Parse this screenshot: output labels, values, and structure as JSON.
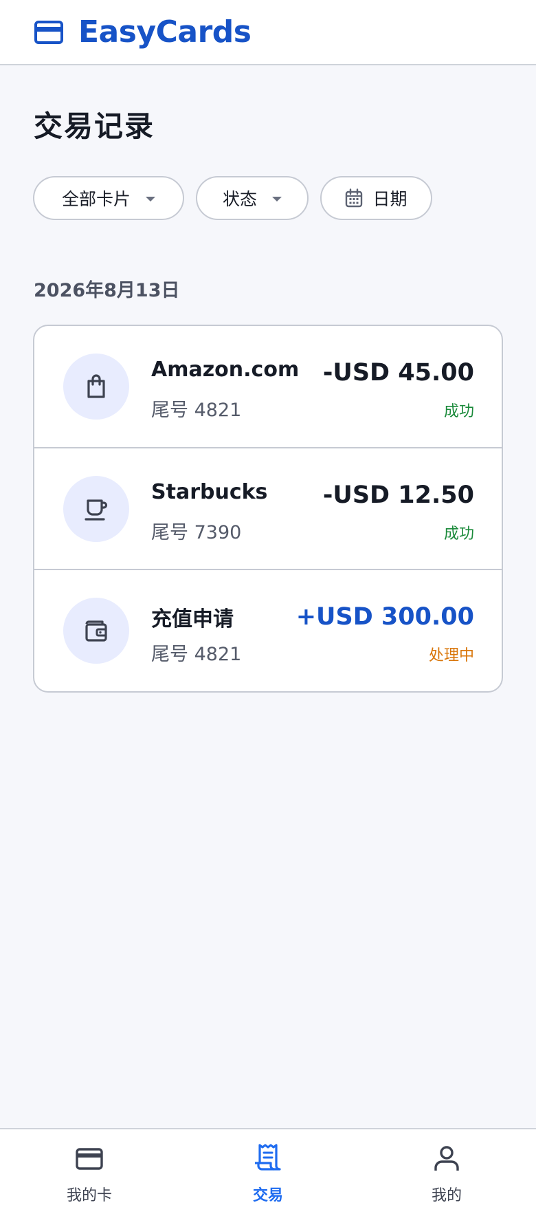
{
  "app": {
    "brand_name": "EasyCards",
    "brand_icon": "credit-card-icon",
    "accent_color": "#1753c7"
  },
  "page": {
    "title": "交易记录"
  },
  "filters": {
    "cards_label": "全部卡片",
    "status_label": "状态",
    "date_label": "日期",
    "date_icon": "calendar-icon"
  },
  "transactions": {
    "date_heading": "2026年8月13日",
    "items": [
      {
        "merchant": "Amazon.com",
        "card_tail": "尾号 4821",
        "amount": "-USD 45.00",
        "status": "成功",
        "icon": "shopping-bag-icon",
        "status_color": "#1a8a3a"
      },
      {
        "merchant": "Starbucks",
        "card_tail": "尾号 7390",
        "amount": "-USD 12.50",
        "status": "成功",
        "icon": "coffee-cup-icon",
        "status_color": "#1a8a3a"
      },
      {
        "merchant": "充值申请",
        "card_tail": "尾号 4821",
        "amount": "+USD 300.00",
        "status": "处理中",
        "icon": "wallet-icon",
        "status_color": "#d9760a"
      }
    ]
  },
  "bottom_nav": {
    "items": [
      {
        "label": "我的卡",
        "icon": "credit-card-icon",
        "active": false
      },
      {
        "label": "交易",
        "icon": "receipt-icon",
        "active": true
      },
      {
        "label": "我的",
        "icon": "user-icon",
        "active": false
      }
    ],
    "active_color": "#1f6cf0"
  }
}
